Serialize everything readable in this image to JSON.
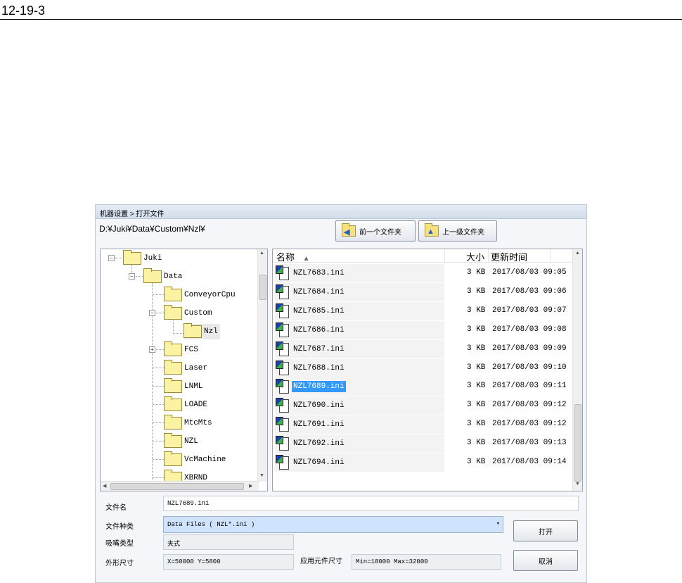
{
  "page": {
    "number": "12-19-3"
  },
  "dialog": {
    "title": "机器设置 > 打开文件",
    "path": "D:¥Juki¥Data¥Custom¥Nzl¥",
    "buttons": {
      "prev_folder": "前一个文件夹",
      "up_folder": "上一级文件夹"
    }
  },
  "tree": {
    "items": [
      {
        "label": "Juki"
      },
      {
        "label": "Data"
      },
      {
        "label": "ConveyorCpu"
      },
      {
        "label": "Custom"
      },
      {
        "label": "Nzl"
      },
      {
        "label": "FCS"
      },
      {
        "label": "Laser"
      },
      {
        "label": "LNML"
      },
      {
        "label": "LOADE"
      },
      {
        "label": "MtcMts"
      },
      {
        "label": "NZL"
      },
      {
        "label": "VcMachine"
      },
      {
        "label": "XBRND"
      }
    ],
    "selected": "Nzl"
  },
  "files": {
    "columns": {
      "name": "名称",
      "size": "大小",
      "modified": "更新时间"
    },
    "sort_indicator": "▲",
    "rows": [
      {
        "name": "NZL7683.ini",
        "size": "3 KB",
        "date": "2017/08/03 09:05"
      },
      {
        "name": "NZL7684.ini",
        "size": "3 KB",
        "date": "2017/08/03 09:06"
      },
      {
        "name": "NZL7685.ini",
        "size": "3 KB",
        "date": "2017/08/03 09:07"
      },
      {
        "name": "NZL7686.ini",
        "size": "3 KB",
        "date": "2017/08/03 09:08"
      },
      {
        "name": "NZL7687.ini",
        "size": "3 KB",
        "date": "2017/08/03 09:09"
      },
      {
        "name": "NZL7688.ini",
        "size": "3 KB",
        "date": "2017/08/03 09:10"
      },
      {
        "name": "NZL7689.ini",
        "size": "3 KB",
        "date": "2017/08/03 09:11"
      },
      {
        "name": "NZL7690.ini",
        "size": "3 KB",
        "date": "2017/08/03 09:12"
      },
      {
        "name": "NZL7691.ini",
        "size": "3 KB",
        "date": "2017/08/03 09:12"
      },
      {
        "name": "NZL7692.ini",
        "size": "3 KB",
        "date": "2017/08/03 09:13"
      },
      {
        "name": "NZL7694.ini",
        "size": "3 KB",
        "date": "2017/08/03 09:14"
      }
    ],
    "selected": "NZL7689.ini"
  },
  "form": {
    "filename_label": "文件名",
    "filename_value": "NZL7689.ini",
    "filetype_label": "文件种类",
    "filetype_value": "Data Files ( NZL*.ini )",
    "nozzle_type_label": "吸嘴类型",
    "nozzle_type_value": "夹式",
    "outer_size_label": "外形尺寸",
    "outer_size_value": "X=50000 Y=5800",
    "component_size_label": "应用元件尺寸",
    "component_size_value": "Min=18000 Max=32000",
    "open_button": "打开",
    "cancel_button": "取消"
  },
  "colors": {
    "selection": "#3399ff",
    "select_field": "#cfe3fc",
    "folder": "#fbf2a3"
  }
}
